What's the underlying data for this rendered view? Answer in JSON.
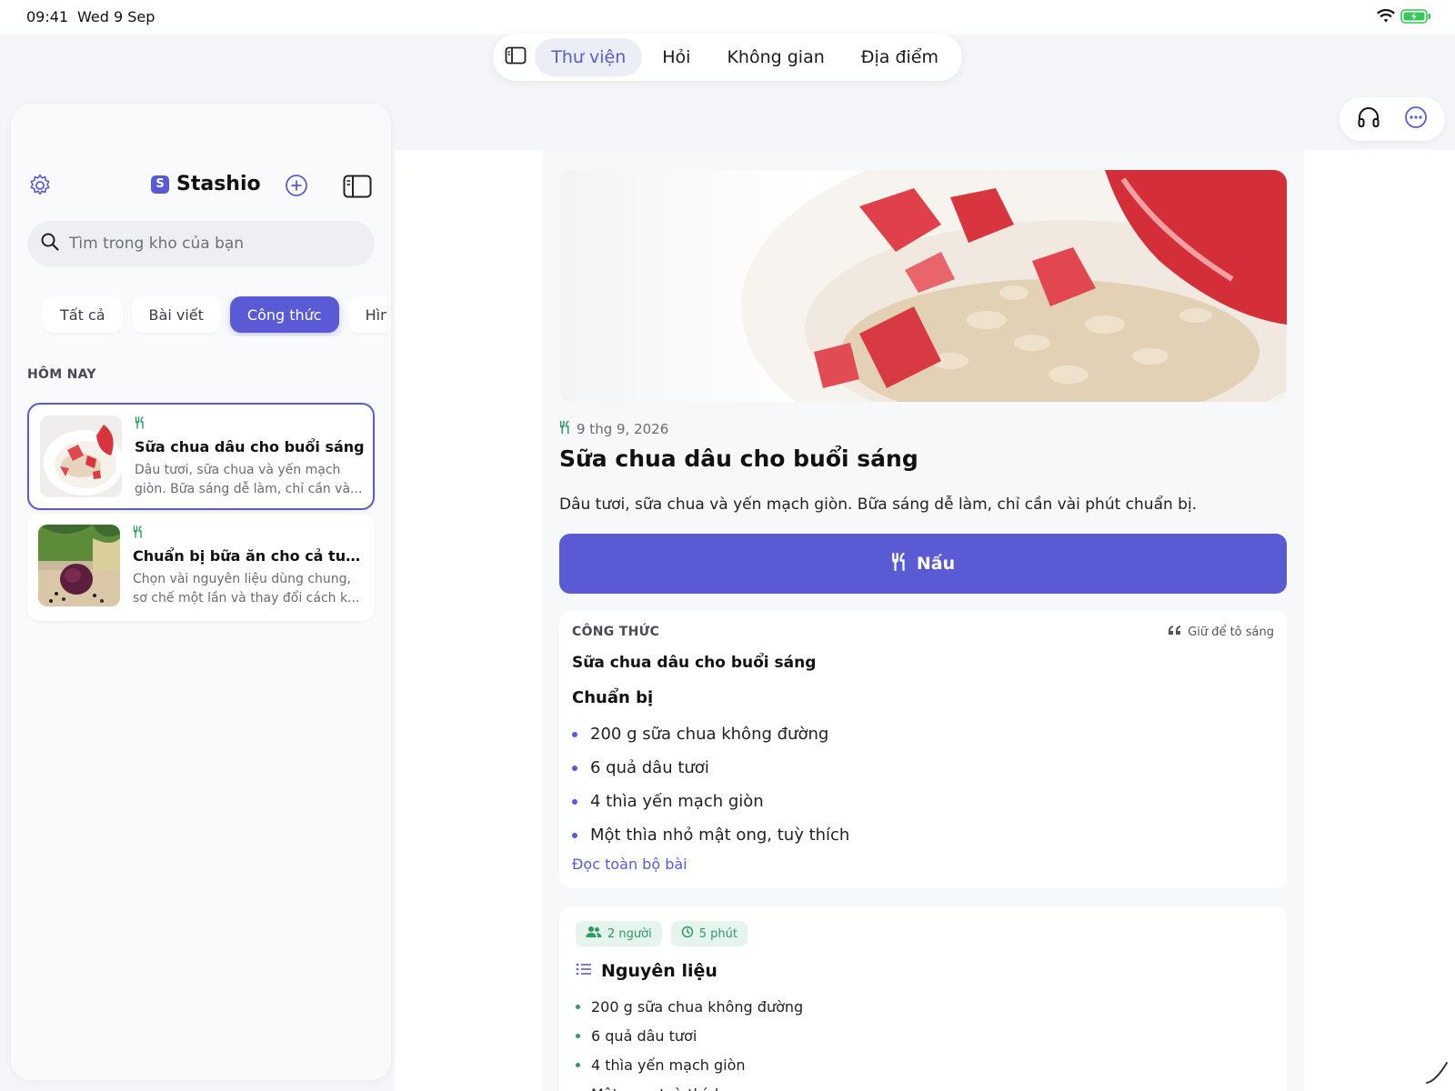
{
  "status_bar": {
    "time": "09:41",
    "date": "Wed 9 Sep"
  },
  "top_nav": {
    "tabs": [
      {
        "label": "Thư viện",
        "active": true
      },
      {
        "label": "Hỏi",
        "active": false
      },
      {
        "label": "Không gian",
        "active": false
      },
      {
        "label": "Địa điểm",
        "active": false
      }
    ]
  },
  "top_right": {
    "icons": [
      "headphones-icon",
      "more-icon"
    ]
  },
  "sidebar": {
    "brand": "Stashio",
    "brand_logo_letter": "S",
    "search": {
      "placeholder": "Tìm trong kho của bạn",
      "value": ""
    },
    "filters": [
      {
        "label": "Tất cả",
        "active": false
      },
      {
        "label": "Bài viết",
        "active": false
      },
      {
        "label": "Công thức",
        "active": true
      },
      {
        "label": "Hình",
        "active": false
      }
    ],
    "section_label": "HÔM NAY",
    "items": [
      {
        "title": "Sữa chua dâu cho buổi sáng",
        "description": "Dâu tươi, sữa chua và yến mạch giòn. Bữa sáng dễ làm, chỉ cần và...",
        "selected": true,
        "icon": "utensils-icon"
      },
      {
        "title": "Chuẩn bị bữa ăn cho cả tuần",
        "description": "Chọn vài nguyên liệu dùng chung, sơ chế một lần và thay đổi cách k...",
        "selected": false,
        "icon": "utensils-icon"
      }
    ]
  },
  "main": {
    "date": "9 thg 9, 2026",
    "title": "Sữa chua dâu cho buổi sáng",
    "description": "Dâu tươi, sữa chua và yến mạch giòn. Bữa sáng dễ làm, chỉ cần vài phút chuẩn bị.",
    "cook_button": "Nấu",
    "recipe": {
      "label": "CÔNG THỨC",
      "hint": "Giữ để tô sáng",
      "title": "Sữa chua dâu cho buổi sáng",
      "subheading": "Chuẩn bị",
      "items": [
        "200 g sữa chua không đường",
        "6 quả dâu tươi",
        "4 thìa yến mạch giòn",
        "Một thìa nhỏ mật ong, tuỳ thích"
      ],
      "read_more": "Đọc toàn bộ bài"
    },
    "ingredients": {
      "servings": "2 người",
      "time": "5 phút",
      "heading": "Nguyên liệu",
      "items": [
        "200 g sữa chua không đường",
        "6 quả dâu tươi",
        "4 thìa yến mạch giòn",
        "Mật ong, tuỳ thích"
      ]
    }
  },
  "colors": {
    "accent": "#5a5bd4",
    "green": "#2e9b63",
    "background": "#f5f6f9"
  }
}
